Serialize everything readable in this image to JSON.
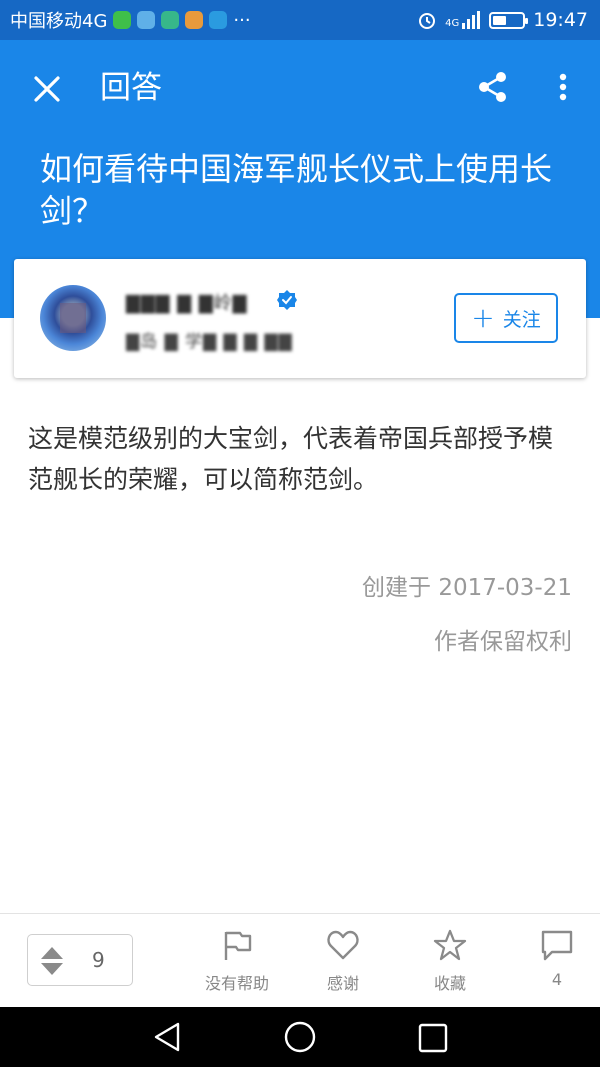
{
  "status_bar": {
    "carrier": "中国移动4G",
    "more": "···",
    "network_badge": "4G",
    "time": "19:47",
    "battery_level": 0.45
  },
  "toolbar": {
    "title": "回答"
  },
  "question": {
    "title": "如何看待中国海军舰长仪式上使用长剑？"
  },
  "author": {
    "name": "▇▇▇ ▇ ▇岭▇",
    "bio": "▇岛 ▇ 学▇ ▇ ▇ ▇▇",
    "follow_label": "关注"
  },
  "answer": {
    "text": "这是模范级别的大宝剑，代表着帝国兵部授予模范舰长的荣耀，可以简称范剑。",
    "created": "创建于 2017-03-21",
    "copyright": "作者保留权利"
  },
  "actions": {
    "vote_count": "9",
    "unhelpful_label": "没有帮助",
    "thanks_label": "感谢",
    "collect_label": "收藏",
    "comments_count": "4"
  },
  "colors": {
    "status_bar": "#1668c4",
    "header": "#1a86e8",
    "accent": "#1a86e8"
  }
}
